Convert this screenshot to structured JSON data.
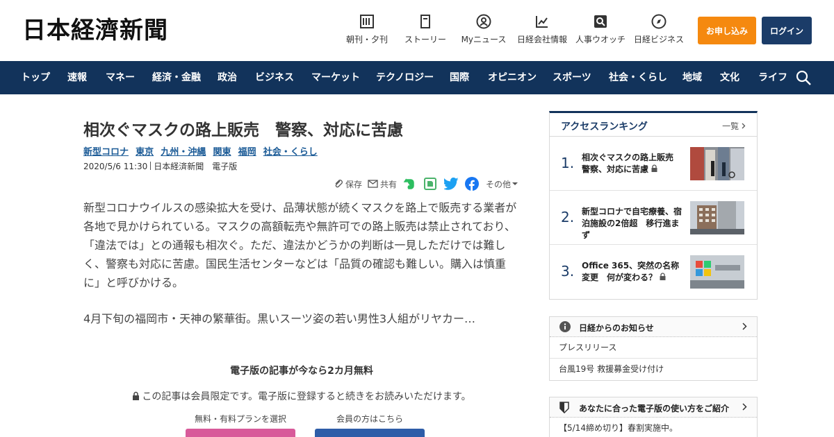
{
  "header": {
    "logo": "日本経濟新聞",
    "icons": [
      {
        "label": "朝刊・夕刊",
        "icon": "newspaper-icon"
      },
      {
        "label": "ストーリー",
        "icon": "book-icon"
      },
      {
        "label": "Myニュース",
        "icon": "user-icon"
      },
      {
        "label": "日経会社情報",
        "icon": "chart-icon"
      },
      {
        "label": "人事ウオッチ",
        "icon": "search-person-icon"
      },
      {
        "label": "日経ビジネス",
        "icon": "compass-icon"
      }
    ],
    "apply_label": "お申し込み",
    "login_label": "ログイン"
  },
  "nav": {
    "items": [
      "トップ",
      "速報",
      "マネー",
      "経済・金融",
      "政治",
      "ビジネス",
      "マーケット",
      "テクノロジー",
      "国際",
      "オピニオン",
      "スポーツ",
      "社会・くらし",
      "地域",
      "文化",
      "ライフ"
    ]
  },
  "article": {
    "title": "相次ぐマスクの路上販売　警察、対応に苦慮",
    "tags": [
      "新型コロナ",
      "東京",
      "九州・沖縄",
      "関東",
      "福岡",
      "社会・くらし"
    ],
    "date": "2020/5/6 11:30",
    "source": "日本経済新聞　電子版",
    "share": {
      "save": "保存",
      "share": "共有",
      "other": "その他"
    },
    "body1": "新型コロナウイルスの感染拡大を受け、品薄状態が続くマスクを路上で販売する業者が各地で見かけられている。マスクの高額転売や無許可での路上販売は禁止されており、「違法では」との通報も相次ぐ。ただ、違法かどうかの判断は一見しただけでは難しく、警察も対応に苦慮。国民生活センターなどは「品質の確認も難しい。購入は慎重に」と呼びかける。",
    "body2": "4月下旬の福岡市・天神の繁華街。黒いスーツ姿の若い男性3人組がリヤカー…",
    "promo_title": "電子版の記事が今なら2カ月無料",
    "promo_lock": "この記事は会員限定です。電子版に登録すると続きをお読みいただけます。",
    "plan_label": "無料・有料プランを選択",
    "member_label": "会員の方はこちら"
  },
  "ranking": {
    "title": "アクセスランキング",
    "more": "一覧",
    "items": [
      {
        "num": "1.",
        "text": "相次ぐマスクの路上販売　警察、対応に苦慮",
        "locked": true
      },
      {
        "num": "2.",
        "text": "新型コロナで自宅療養、宿泊施設の2倍超　移行進まず",
        "locked": false
      },
      {
        "num": "3.",
        "text": "Office 365、突然の名称変更　何が変わる？",
        "locked": true
      }
    ]
  },
  "notices": {
    "title": "日経からのお知らせ",
    "items": [
      "プレスリリース",
      "台風19号 救援募金受け付け"
    ]
  },
  "guide": {
    "title": "あなたに合った電子版の使い方をご紹介",
    "items": [
      "【5/14締め切り】春割実施中。"
    ]
  },
  "colors": {
    "nav_bg": "#12335b",
    "apply": "#f5890f",
    "login": "#1b3c68",
    "tag_link": "#1a5a96"
  }
}
